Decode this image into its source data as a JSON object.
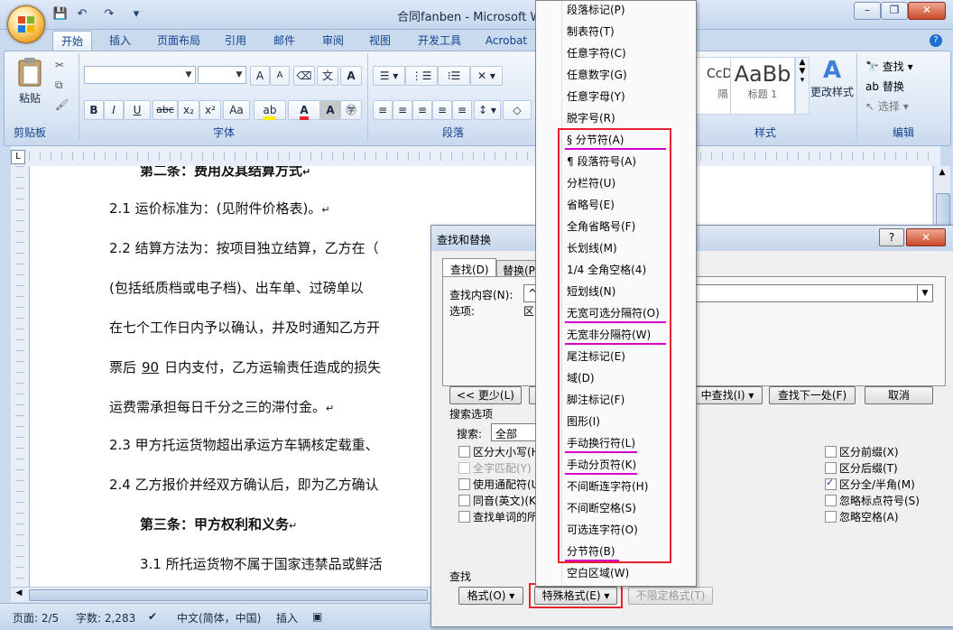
{
  "window": {
    "title": "合同fanben - Microsoft W",
    "controls": {
      "minimize": "–",
      "restore": "❐",
      "close": "✕"
    }
  },
  "ribbon_tabs": [
    "开始",
    "插入",
    "页面布局",
    "引用",
    "邮件",
    "审阅",
    "视图",
    "开发工具",
    "Acrobat"
  ],
  "ribbon": {
    "clipboard": {
      "paste": "粘贴",
      "label": "剪贴板"
    },
    "font": {
      "label": "字体",
      "bold": "B",
      "italic": "I",
      "underline": "U",
      "strike": "abc",
      "sub": "x₂",
      "sup": "x²",
      "aa": "Aa",
      "grow": "A",
      "shrink": "A"
    },
    "paragraph": {
      "label": "段落"
    },
    "styles": {
      "label": "样式",
      "style1_preview": "CcDc",
      "style1_name": "隔",
      "style2_preview": "AaBb",
      "style2_name": "标题 1",
      "change_styles": "更改样式"
    },
    "editing": {
      "label": "编辑",
      "find": "查找",
      "replace": "替换",
      "select": "选择"
    }
  },
  "document": {
    "lines": [
      "第二条：费用及其结算方式",
      "2.1 运价标准为：(见附件价格表)。",
      "2.2 结算方法为：按项目独立结算，乙方在（",
      "(包括纸质档或电子档)、出车单、过磅单以",
      "在七个工作日内予以确认，并及时通知乙方开",
      "票后",
      "日内支付，乙方运输责任造成的损失",
      "运费需承担每日千分之三的滞付金。",
      "2.3 甲方托运货物超出承运方车辆核定载重、",
      "2.4 乙方报价并经双方确认后，即为乙方确认",
      "第三条：甲方权利和义务",
      "3.1 所托运货物不属于国家违禁品或鲜活"
    ],
    "underlined_value": "90",
    "return_mark": "↵"
  },
  "status_bar": {
    "page": "页面: 2/5",
    "words": "字数: 2,283",
    "language": "中文(简体，中国)",
    "mode": "插入"
  },
  "dialog": {
    "title": "查找和替换",
    "help": "?",
    "tabs": {
      "find": "查找(D)",
      "replace": "替换(P)"
    },
    "find_label": "查找内容(N):",
    "find_value": "^1",
    "options_label": "选项:",
    "options_value": "区",
    "less_button": "<< 更少(L)",
    "find_in_button": "中查找(I) ▾",
    "find_next_button": "查找下一处(F)",
    "cancel_button": "取消",
    "search_options_title": "搜索选项",
    "search_label": "搜索:",
    "search_value": "全部",
    "left_options": [
      {
        "label": "区分大小写(H)",
        "checked": false,
        "disabled": false
      },
      {
        "label": "全字匹配(Y)",
        "checked": false,
        "disabled": true
      },
      {
        "label": "使用通配符(U)",
        "checked": false,
        "disabled": false
      },
      {
        "label": "同音(英文)(K)",
        "checked": false,
        "disabled": false
      },
      {
        "label": "查找单词的所",
        "checked": false,
        "disabled": false
      }
    ],
    "right_options": [
      {
        "label": "区分前缀(X)",
        "checked": false
      },
      {
        "label": "区分后缀(T)",
        "checked": false
      },
      {
        "label": "区分全/半角(M)",
        "checked": true
      },
      {
        "label": "忽略标点符号(S)",
        "checked": false
      },
      {
        "label": "忽略空格(A)",
        "checked": false
      }
    ],
    "find_section_label": "查找",
    "format_button": "格式(O) ▾",
    "special_button": "特殊格式(E) ▾",
    "no_format_button": "不限定格式(T)"
  },
  "special_menu": [
    "段落标记(P)",
    "制表符(T)",
    "任意字符(C)",
    "任意数字(G)",
    "任意字母(Y)",
    "脱字号(R)",
    "§ 分节符(A)",
    "¶ 段落符号(A)",
    "分栏符(U)",
    "省略号(E)",
    "全角省略号(F)",
    "长划线(M)",
    "1/4 全角空格(4)",
    "短划线(N)",
    "无宽可选分隔符(O)",
    "无宽非分隔符(W)",
    "尾注标记(E)",
    "域(D)",
    "脚注标记(F)",
    "图形(I)",
    "手动换行符(L)",
    "手动分页符(K)",
    "不间断连字符(H)",
    "不间断空格(S)",
    "可选连字符(O)",
    "分节符(B)",
    "空白区域(W)"
  ]
}
